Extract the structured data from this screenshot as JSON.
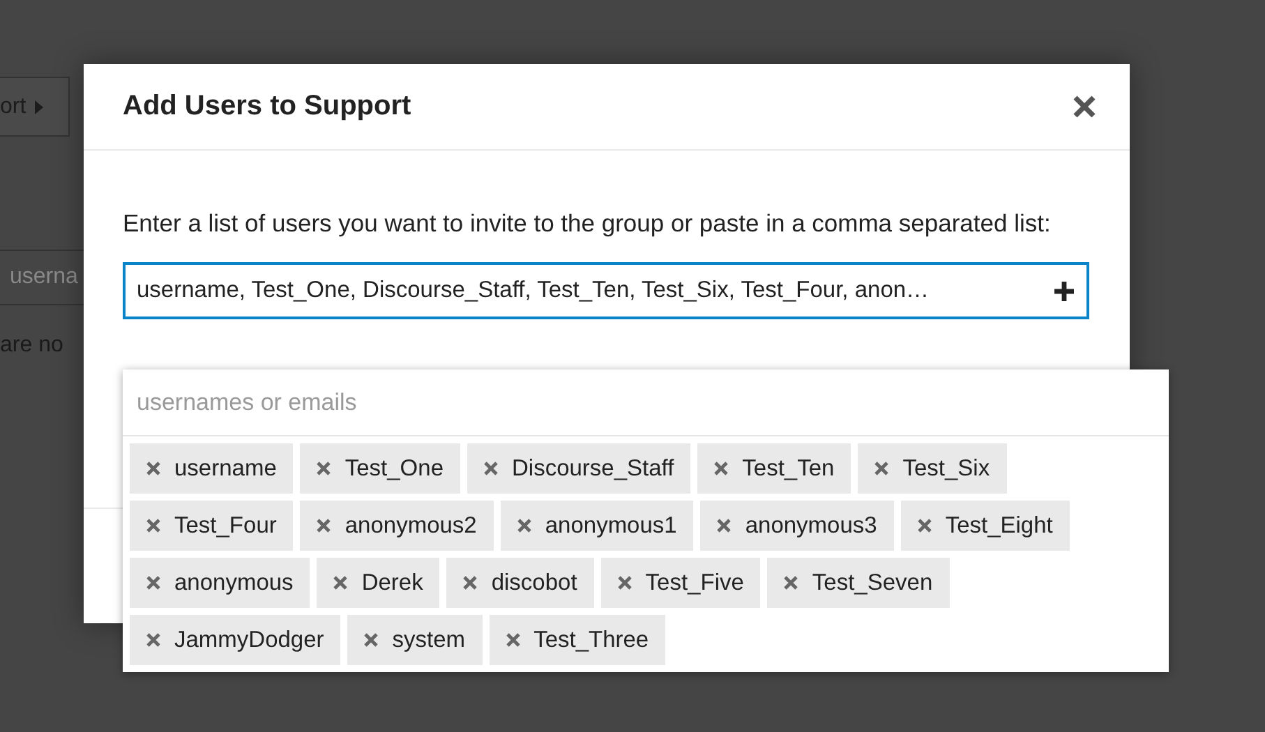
{
  "background": {
    "button_label": "ort",
    "field_placeholder": "userna",
    "message": "are no"
  },
  "dialog": {
    "title": "Add Users to Support",
    "instructions": "Enter a list of users you want to invite to the group or paste in a comma separated list:",
    "field_value": "username, Test_One, Discourse_Staff, Test_Ten, Test_Six, Test_Four, anon…"
  },
  "dropdown": {
    "placeholder": "usernames or emails",
    "users": [
      {
        "name": "username"
      },
      {
        "name": "Test_One"
      },
      {
        "name": "Discourse_Staff"
      },
      {
        "name": "Test_Ten"
      },
      {
        "name": "Test_Six"
      },
      {
        "name": "Test_Four"
      },
      {
        "name": "anonymous2"
      },
      {
        "name": "anonymous1"
      },
      {
        "name": "anonymous3"
      },
      {
        "name": "Test_Eight"
      },
      {
        "name": "anonymous"
      },
      {
        "name": "Derek"
      },
      {
        "name": "discobot"
      },
      {
        "name": "Test_Five"
      },
      {
        "name": "Test_Seven"
      },
      {
        "name": "JammyDodger"
      },
      {
        "name": "system"
      },
      {
        "name": "Test_Three"
      }
    ]
  }
}
